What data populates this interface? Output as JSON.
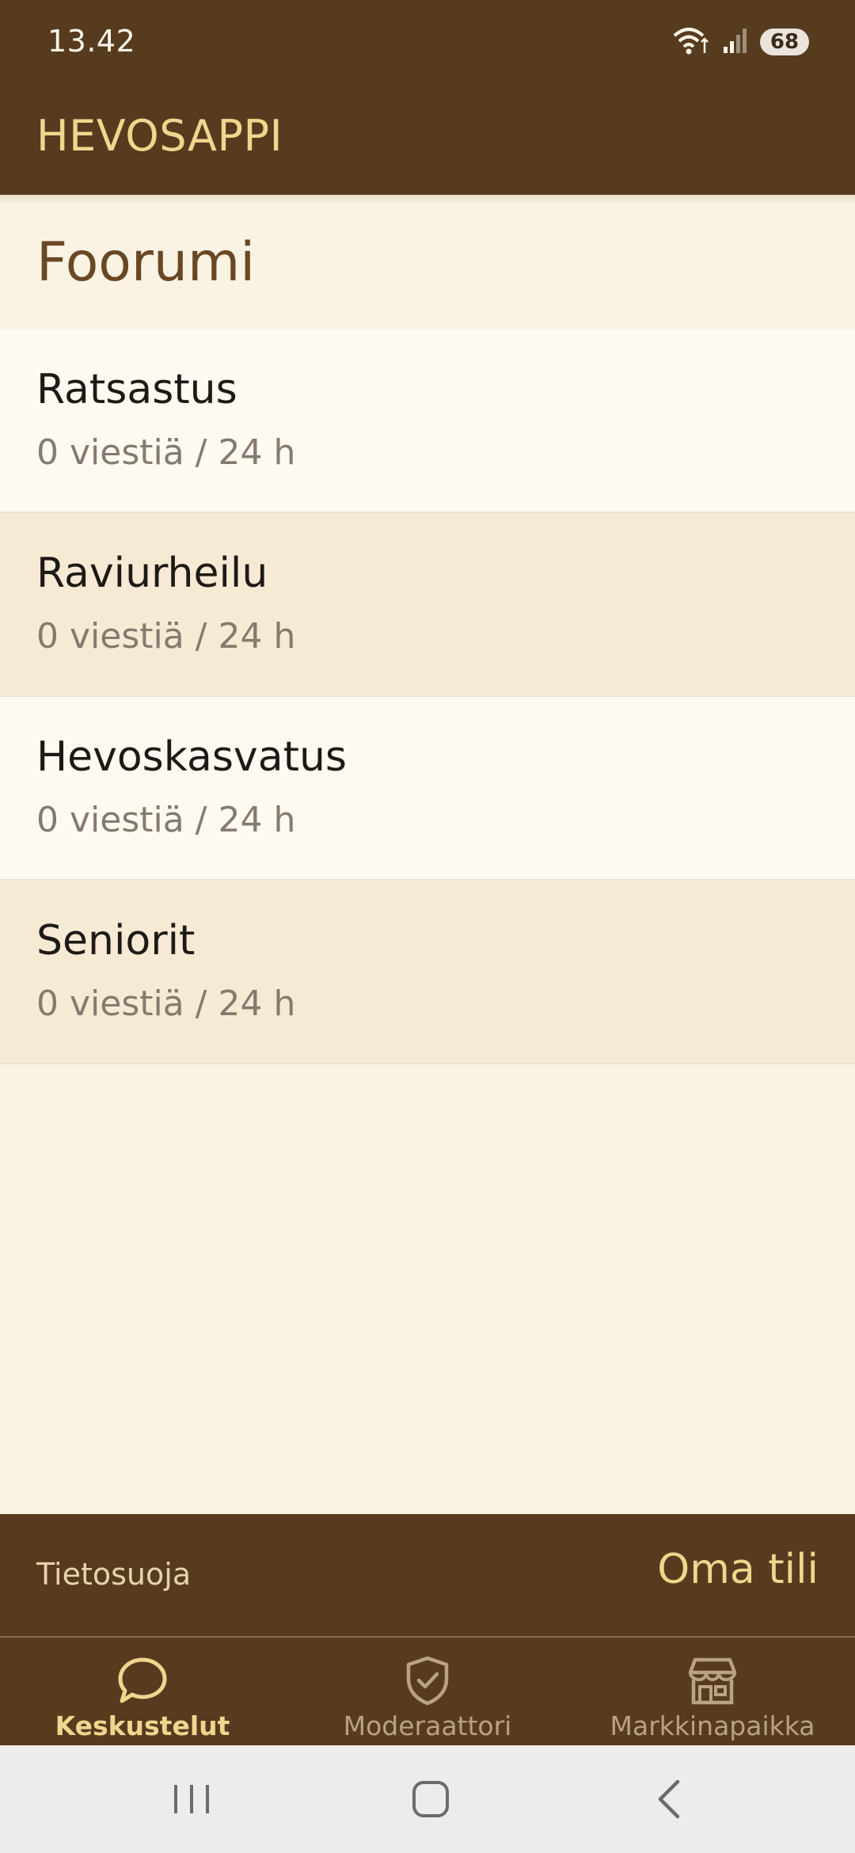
{
  "status_bar": {
    "time": "13.42",
    "battery_level": "68",
    "icons": [
      "wifi-icon",
      "signal-icon",
      "battery-icon"
    ]
  },
  "app_bar": {
    "title": "HEVOSAPPI"
  },
  "section": {
    "title": "Foorumi"
  },
  "forums": [
    {
      "name": "Ratsastus",
      "meta": "0 viestiä / 24 h"
    },
    {
      "name": "Raviurheilu",
      "meta": "0 viestiä / 24 h"
    },
    {
      "name": "Hevoskasvatus",
      "meta": "0 viestiä / 24 h"
    },
    {
      "name": "Seniorit",
      "meta": "0 viestiä / 24 h"
    }
  ],
  "footer": {
    "privacy_label": "Tietosuoja",
    "account_label": "Oma tili"
  },
  "bottom_nav": {
    "items": [
      {
        "label": "Keskustelut",
        "icon": "chat-bubble-icon",
        "active": true
      },
      {
        "label": "Moderaattori",
        "icon": "shield-check-icon",
        "active": false
      },
      {
        "label": "Markkinapaikka",
        "icon": "storefront-icon",
        "active": false
      }
    ]
  },
  "system_nav": {
    "icons": [
      "recent-apps-icon",
      "home-icon",
      "back-icon"
    ]
  },
  "colors": {
    "brand_brown": "#573b1e",
    "accent_gold": "#f0d58e",
    "background_cream": "#faf2e3",
    "row_light": "#fefaf2",
    "row_tan": "#f7ead5"
  }
}
